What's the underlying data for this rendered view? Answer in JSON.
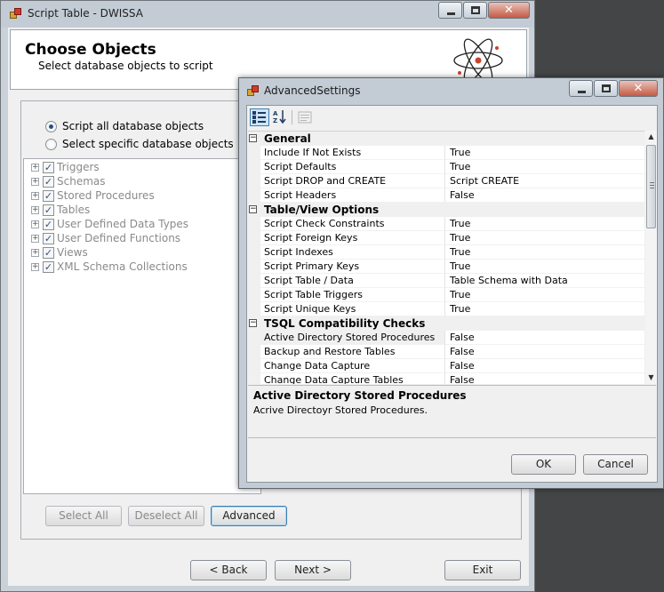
{
  "main_window": {
    "title": "Script Table - DWISSA",
    "header": {
      "title": "Choose Objects",
      "subtitle": "Select database objects to script"
    },
    "radio_options": [
      {
        "label": "Script all database objects",
        "selected": true
      },
      {
        "label": "Select specific database objects",
        "selected": false
      }
    ],
    "tree_items": [
      {
        "label": "Triggers",
        "checked": true
      },
      {
        "label": "Schemas",
        "checked": true
      },
      {
        "label": "Stored Procedures",
        "checked": true
      },
      {
        "label": "Tables",
        "checked": true
      },
      {
        "label": "User Defined Data Types",
        "checked": true
      },
      {
        "label": "User Defined Functions",
        "checked": true
      },
      {
        "label": "Views",
        "checked": true
      },
      {
        "label": "XML Schema Collections",
        "checked": true
      }
    ],
    "buttons": {
      "select_all": "Select All",
      "deselect_all": "Deselect All",
      "advanced": "Advanced",
      "back": "< Back",
      "next": "Next >",
      "exit": "Exit"
    }
  },
  "advanced_window": {
    "title": "AdvancedSettings",
    "categories": [
      {
        "name": "General",
        "properties": [
          {
            "name": "Include If Not Exists",
            "value": "True"
          },
          {
            "name": "Script Defaults",
            "value": "True"
          },
          {
            "name": "Script DROP and CREATE",
            "value": "Script CREATE"
          },
          {
            "name": "Script Headers",
            "value": "False"
          }
        ]
      },
      {
        "name": "Table/View Options",
        "properties": [
          {
            "name": "Script Check Constraints",
            "value": "True"
          },
          {
            "name": "Script Foreign Keys",
            "value": "True"
          },
          {
            "name": "Script Indexes",
            "value": "True"
          },
          {
            "name": "Script Primary Keys",
            "value": "True"
          },
          {
            "name": "Script Table / Data",
            "value": "Table Schema with Data"
          },
          {
            "name": "Script Table Triggers",
            "value": "True"
          },
          {
            "name": "Script Unique Keys",
            "value": "True"
          }
        ]
      },
      {
        "name": "TSQL Compatibility Checks",
        "properties": [
          {
            "name": "Active Directory Stored Procedures",
            "value": "False"
          },
          {
            "name": "Backup and Restore Tables",
            "value": "False"
          },
          {
            "name": "Change Data Capture",
            "value": "False"
          },
          {
            "name": "Change Data Capture Tables",
            "value": "False"
          }
        ]
      }
    ],
    "help": {
      "title": "Active Directory Stored Procedures",
      "description": "Acrive Directoyr Stored Procedures."
    },
    "buttons": {
      "ok": "OK",
      "cancel": "Cancel"
    }
  },
  "colors": {
    "titlebar": "#c3ccd5",
    "close_button": "#c45a44",
    "focus_border": "#3c7fb1",
    "disabled_text": "#8a8a8a"
  }
}
